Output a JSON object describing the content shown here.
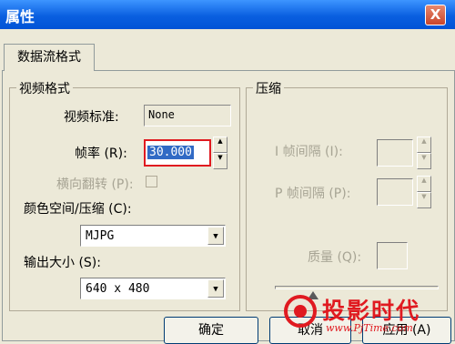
{
  "window": {
    "title": "属性",
    "close_glyph": "X"
  },
  "tabs": [
    {
      "label": "数据流格式"
    }
  ],
  "video_format": {
    "group_title": "视频格式",
    "standard_label": "视频标准:",
    "standard_value": "None",
    "framerate_label": "帧率 (R):",
    "framerate_value": "30.000",
    "flip_label": "横向翻转 (P):",
    "colorspace_label": "颜色空间/压缩 (C):",
    "colorspace_value": "MJPG",
    "output_size_label": "输出大小 (S):",
    "output_size_value": "640 x 480"
  },
  "compression": {
    "group_title": "压缩",
    "i_interval_label": "I 帧间隔 (I):",
    "p_interval_label": "P 帧间隔 (P):",
    "quality_label": "质量 (Q):"
  },
  "buttons": {
    "ok": "确定",
    "cancel": "取消",
    "apply": "应用 (A)"
  },
  "watermark": {
    "text": "投影时代",
    "url": "www.PjTime.com"
  },
  "colors": {
    "title_bar": "#0a5fe0",
    "dialog_bg": "#ece9d8",
    "highlight_border": "#e01a20"
  }
}
